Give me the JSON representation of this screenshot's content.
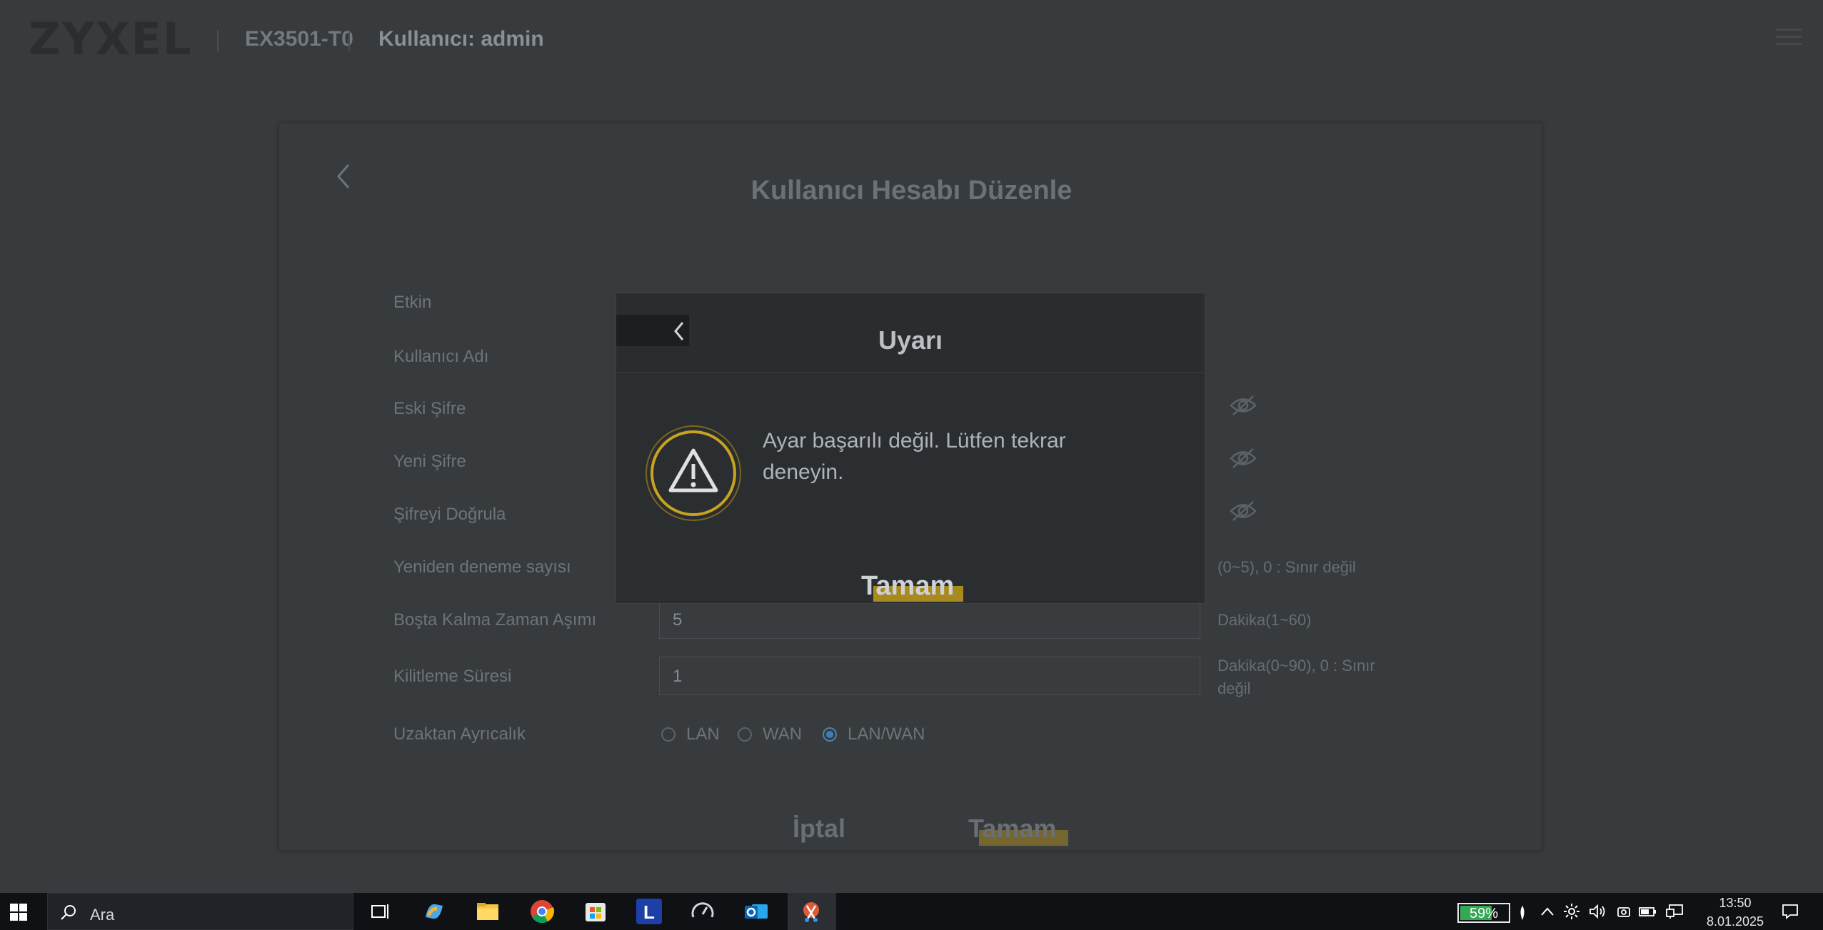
{
  "header": {
    "logo": "ZYXEL",
    "model": "EX3501-T0",
    "user_label": "Kullanıcı: admin"
  },
  "page": {
    "title": "Kullanıcı Hesabı Düzenle",
    "fields": {
      "enabled_label": "Etkin",
      "username_label": "Kullanıcı Adı",
      "old_password_label": "Eski Şifre",
      "new_password_label": "Yeni Şifre",
      "verify_password_label": "Şifreyi Doğrula",
      "retry_label": "Yeniden deneme sayısı",
      "retry_hint": "(0~5), 0 : Sınır değil",
      "idle_label": "Boşta Kalma Zaman Aşımı",
      "idle_value": "5",
      "idle_hint": "Dakika(1~60)",
      "lockout_label": "Kilitleme Süresi",
      "lockout_value": "1",
      "lockout_hint_1": "Dakika(0~90), 0 : Sınır",
      "lockout_hint_2": "değil",
      "remote_label": "Uzaktan Ayrıcalık",
      "remote_options": [
        "LAN",
        "WAN",
        "LAN/WAN"
      ],
      "remote_selected": "LAN/WAN"
    },
    "cancel_label": "İptal",
    "ok_label": "Tamam"
  },
  "modal": {
    "title": "Uyarı",
    "message": "Ayar başarılı değil. Lütfen tekrar deneyin.",
    "ok_label": "Tamam"
  },
  "taskbar": {
    "search_placeholder": "Ara",
    "battery_percent": "59%",
    "time": "13:50",
    "date": "8.01.2025",
    "apps": [
      "task-view-icon",
      "copilot-icon",
      "file-explorer-icon",
      "chrome-icon",
      "store-icon",
      "l-app-icon",
      "speedometer-icon",
      "outlook-icon",
      "snipping-tool-icon"
    ]
  },
  "colors": {
    "accent_highlight": "#a88a20",
    "warning_ring": "#c9a31e",
    "radio_selected": "#3f7fb8",
    "battery": "#34a853"
  }
}
